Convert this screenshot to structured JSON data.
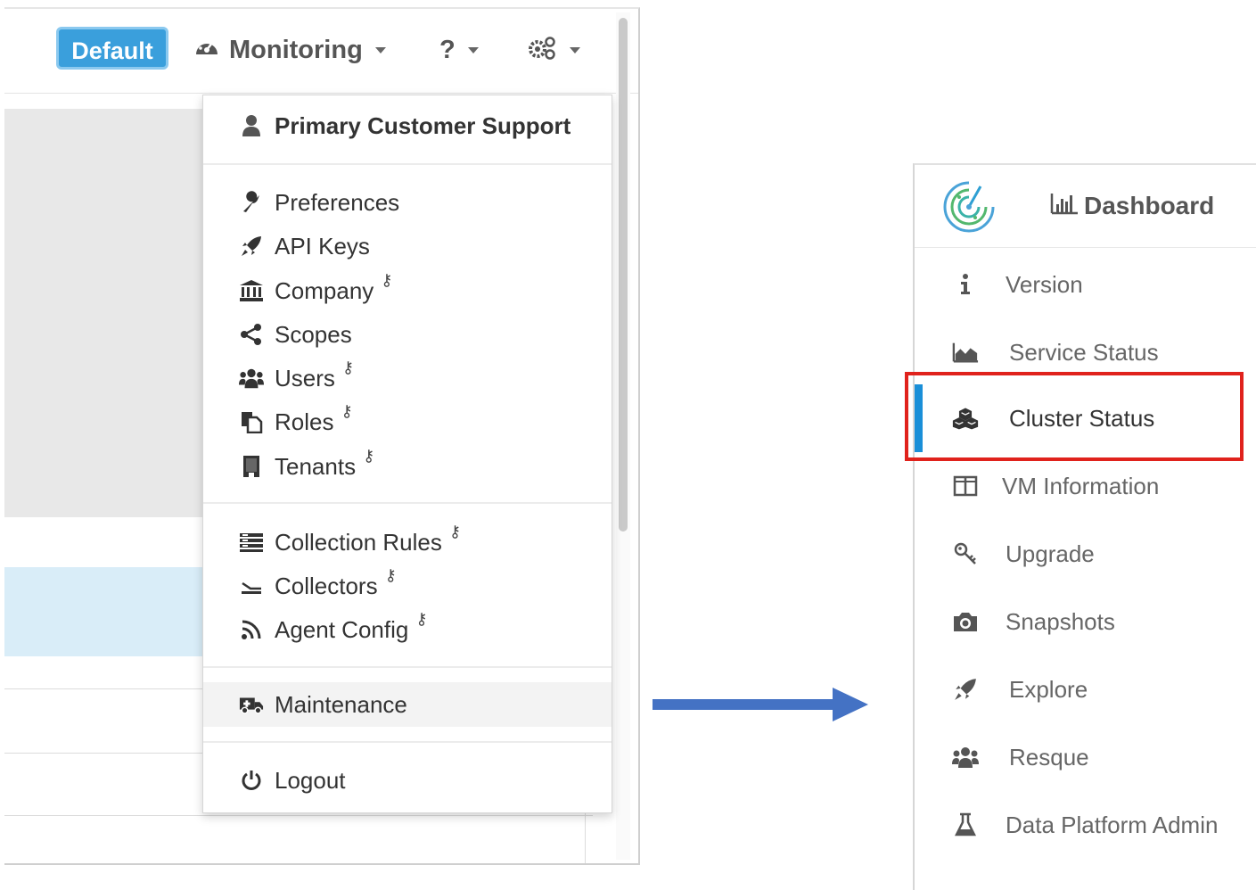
{
  "topbar": {
    "default_button": "Default",
    "monitoring": "Monitoring",
    "help": "?"
  },
  "user_menu": {
    "header": "Primary Customer Support",
    "items": [
      {
        "label": "Preferences",
        "icon": "wrench-icon",
        "admin_key": false
      },
      {
        "label": "API Keys",
        "icon": "rocket-icon",
        "admin_key": false
      },
      {
        "label": "Company",
        "icon": "bank-icon",
        "admin_key": true
      },
      {
        "label": "Scopes",
        "icon": "share-icon",
        "admin_key": false
      },
      {
        "label": "Users",
        "icon": "users-icon",
        "admin_key": true
      },
      {
        "label": "Roles",
        "icon": "copy-icon",
        "admin_key": true
      },
      {
        "label": "Tenants",
        "icon": "building-icon",
        "admin_key": true
      },
      {
        "label": "Collection Rules",
        "icon": "list-icon",
        "admin_key": true
      },
      {
        "label": "Collectors",
        "icon": "collector-icon",
        "admin_key": true
      },
      {
        "label": "Agent Config",
        "icon": "rss-icon",
        "admin_key": true
      },
      {
        "label": "Maintenance",
        "icon": "ambulance-icon",
        "admin_key": false
      },
      {
        "label": "Logout",
        "icon": "power-icon",
        "admin_key": false
      }
    ]
  },
  "sidebar": {
    "title": "Dashboard",
    "items": [
      {
        "label": "Version",
        "icon": "info-icon"
      },
      {
        "label": "Service Status",
        "icon": "area-chart-icon"
      },
      {
        "label": "Cluster Status",
        "icon": "cubes-icon",
        "active": true
      },
      {
        "label": "VM Information",
        "icon": "columns-icon"
      },
      {
        "label": "Upgrade",
        "icon": "key-icon"
      },
      {
        "label": "Snapshots",
        "icon": "camera-icon"
      },
      {
        "label": "Explore",
        "icon": "rocket-icon"
      },
      {
        "label": "Resque",
        "icon": "users-icon"
      },
      {
        "label": "Data Platform Admin",
        "icon": "flask-icon"
      }
    ]
  },
  "colors": {
    "accent_blue": "#1a8fd8",
    "button_blue": "#3a9fdc",
    "highlight_red": "#e0221c",
    "arrow_blue": "#4472c4"
  }
}
